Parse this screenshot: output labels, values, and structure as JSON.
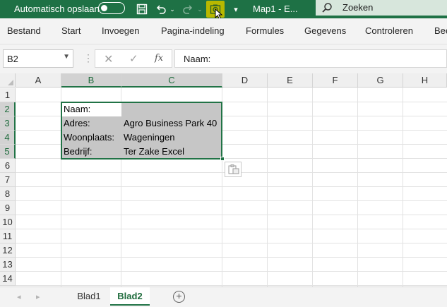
{
  "titlebar": {
    "autosave_label": "Automatisch opslaan",
    "doc_title": "Map1  -  E...",
    "search_placeholder": "Zoeken"
  },
  "ribbon": {
    "tabs": [
      "Bestand",
      "Start",
      "Invoegen",
      "Pagina-indeling",
      "Formules",
      "Gegevens",
      "Controleren",
      "Bee"
    ]
  },
  "formula_bar": {
    "name_box": "B2",
    "fx_label": "fx",
    "content": "Naam:"
  },
  "grid": {
    "columns": [
      "A",
      "B",
      "C",
      "D",
      "E",
      "F",
      "G",
      "H"
    ],
    "rows": [
      "1",
      "2",
      "3",
      "4",
      "5",
      "6",
      "7",
      "8",
      "9",
      "10",
      "11",
      "12",
      "13",
      "14"
    ],
    "cells": {
      "b2": "Naam:",
      "b3": "Adres:",
      "c3": "Agro Business Park 40",
      "b4": "Woonplaats:",
      "c4": "Wageningen",
      "b5": "Bedrijf:",
      "c5": "Ter Zake Excel"
    }
  },
  "sheets": {
    "tabs": [
      "Blad1",
      "Blad2"
    ],
    "active": "Blad2"
  },
  "colors": {
    "accent": "#217346",
    "titlebar": "#1e7145",
    "selection": "#c6c6c6"
  }
}
